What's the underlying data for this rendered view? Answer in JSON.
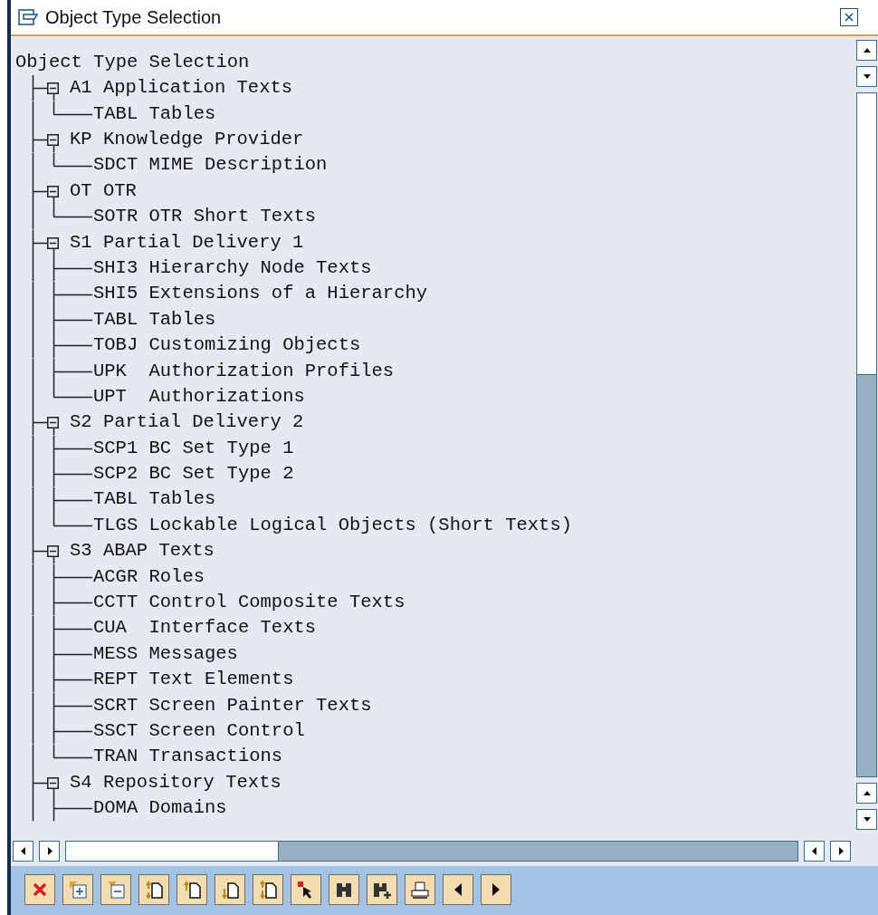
{
  "window": {
    "title": "Object Type Selection"
  },
  "tree": {
    "root": "Object Type Selection",
    "groups": [
      {
        "label": "A1 Application Texts",
        "expanded": true,
        "children": [
          "TABL Tables"
        ]
      },
      {
        "label": "KP Knowledge Provider",
        "expanded": true,
        "children": [
          "SDCT MIME Description"
        ]
      },
      {
        "label": "OT OTR",
        "expanded": true,
        "children": [
          "SOTR OTR Short Texts"
        ]
      },
      {
        "label": "S1 Partial Delivery 1",
        "expanded": true,
        "children": [
          "SHI3 Hierarchy Node Texts",
          "SHI5 Extensions of a Hierarchy",
          "TABL Tables",
          "TOBJ Customizing Objects",
          "UPK  Authorization Profiles",
          "UPT  Authorizations"
        ]
      },
      {
        "label": "S2 Partial Delivery 2",
        "expanded": true,
        "children": [
          "SCP1 BC Set Type 1",
          "SCP2 BC Set Type 2",
          "TABL Tables",
          "TLGS Lockable Logical Objects (Short Texts)"
        ]
      },
      {
        "label": "S3 ABAP Texts",
        "expanded": true,
        "children": [
          "ACGR Roles",
          "CCTT Control Composite Texts",
          "CUA  Interface Texts",
          "MESS Messages",
          "REPT Text Elements",
          "SCRT Screen Painter Texts",
          "SSCT Screen Control",
          "TRAN Transactions"
        ]
      },
      {
        "label": "S4 Repository Texts",
        "expanded": true,
        "children": [
          "DOMA Domains"
        ]
      }
    ]
  }
}
